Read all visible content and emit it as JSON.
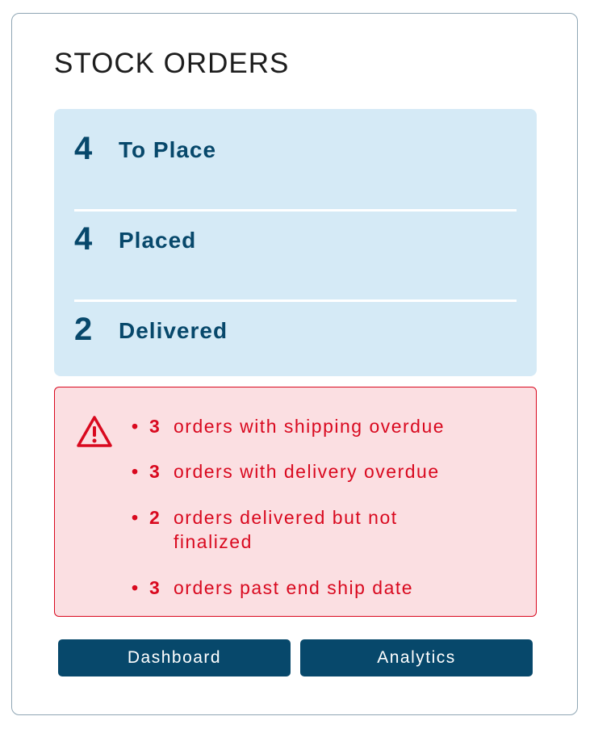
{
  "widget": {
    "title": "STOCK ORDERS"
  },
  "status_summary": [
    {
      "count": "4",
      "label": "To Place"
    },
    {
      "count": "4",
      "label": "Placed"
    },
    {
      "count": "2",
      "label": "Delivered"
    }
  ],
  "alerts": {
    "icon": "warning-triangle-icon",
    "items": [
      {
        "count": "3",
        "text": "orders with shipping overdue"
      },
      {
        "count": "3",
        "text": "orders with delivery overdue"
      },
      {
        "count": "2",
        "text": "orders delivered but not finalized"
      },
      {
        "count": "3",
        "text": "orders past end ship date"
      }
    ]
  },
  "buttons": {
    "dashboard_label": "Dashboard",
    "analytics_label": "Analytics"
  },
  "colors": {
    "primary": "#07486b",
    "status_bg": "#d5eaf6",
    "alert_text": "#d9091f",
    "alert_bg": "#fbdfe2"
  }
}
